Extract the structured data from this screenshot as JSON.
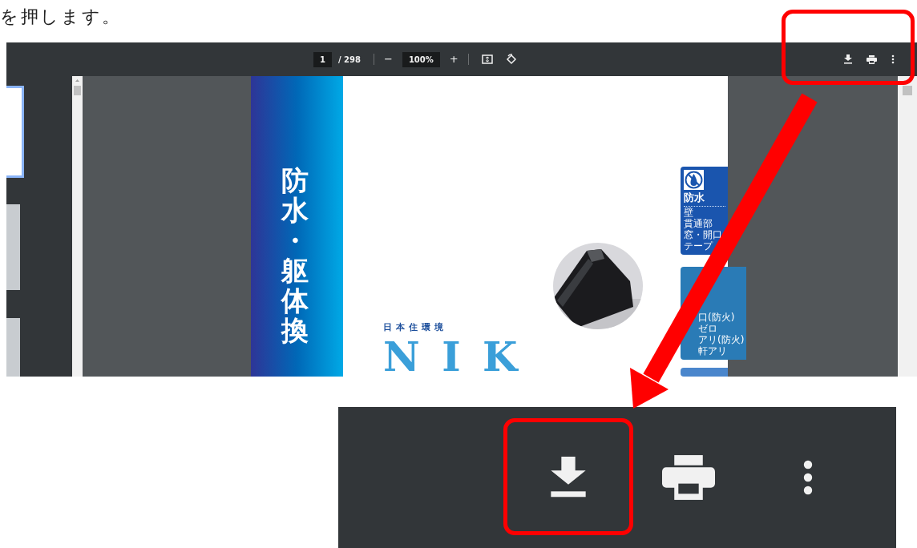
{
  "instruction": "を押します。",
  "viewer": {
    "toolbar": {
      "page": "1",
      "page_count": "/ 298",
      "zoom_out": "−",
      "zoom": "100%",
      "zoom_in": "+"
    },
    "thumbnails": [
      {
        "selected": true
      },
      {
        "selected": false
      },
      {
        "selected": false
      }
    ],
    "document": {
      "vertical_title": "防水・躯体換",
      "brand_caption": "日本住環境",
      "brand_logo": "NIK",
      "tabs": [
        {
          "title": "防水",
          "items": [
            "壁",
            "貫通部",
            "窓・開口",
            "テープ"
          ]
        },
        {
          "items": [
            "口(防火)",
            "ゼロ",
            "アリ(防火)",
            "軒アリ"
          ]
        }
      ]
    }
  }
}
